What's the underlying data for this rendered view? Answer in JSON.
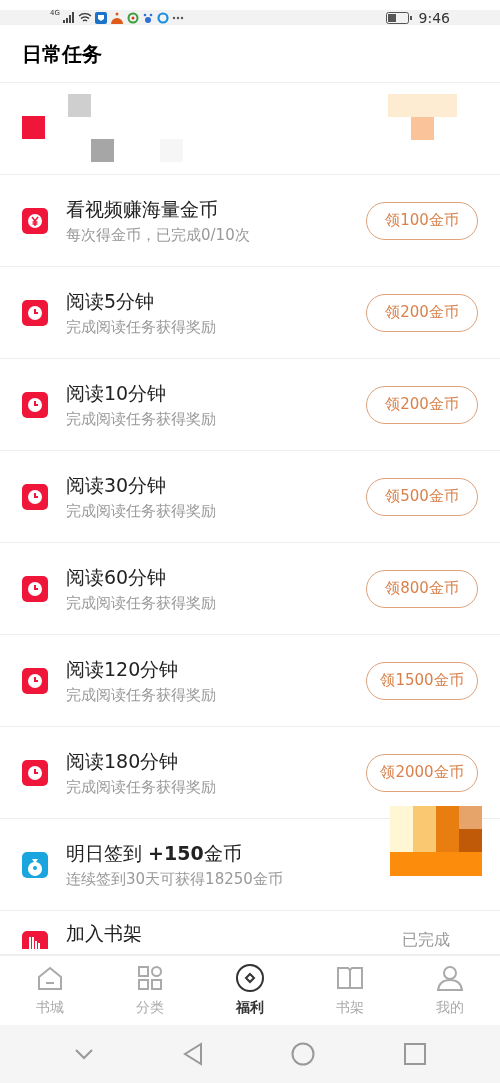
{
  "status_bar": {
    "network": "4G",
    "time": "9:46"
  },
  "header": {
    "title": "日常任务"
  },
  "tasks": [
    {
      "kind": "redacted"
    },
    {
      "kind": "video",
      "title": "看视频赚海量金币",
      "subtitle": "每次得金币，已完成0/10次",
      "button": "领100金币"
    },
    {
      "kind": "reading",
      "title": "阅读5分钟",
      "subtitle": "完成阅读任务获得奖励",
      "button": "领200金币"
    },
    {
      "kind": "reading",
      "title": "阅读10分钟",
      "subtitle": "完成阅读任务获得奖励",
      "button": "领200金币"
    },
    {
      "kind": "reading",
      "title": "阅读30分钟",
      "subtitle": "完成阅读任务获得奖励",
      "button": "领500金币"
    },
    {
      "kind": "reading",
      "title": "阅读60分钟",
      "subtitle": "完成阅读任务获得奖励",
      "button": "领800金币"
    },
    {
      "kind": "reading",
      "title": "阅读120分钟",
      "subtitle": "完成阅读任务获得奖励",
      "button": "领1500金币"
    },
    {
      "kind": "reading",
      "title": "阅读180分钟",
      "subtitle": "完成阅读任务获得奖励",
      "button": "领2000金币"
    },
    {
      "kind": "signin",
      "title": "明日签到 **+150**金币",
      "subtitle": "连续签到30天可获得18250金币"
    },
    {
      "kind": "shelf",
      "title": "加入书架",
      "status": "已完成"
    }
  ],
  "tabs": [
    {
      "kind": "home",
      "label": "书城",
      "selected": false
    },
    {
      "kind": "grid",
      "label": "分类",
      "selected": false
    },
    {
      "kind": "coin",
      "label": "福利",
      "selected": true
    },
    {
      "kind": "book",
      "label": "书架",
      "selected": false
    },
    {
      "kind": "person",
      "label": "我的",
      "selected": false
    }
  ]
}
